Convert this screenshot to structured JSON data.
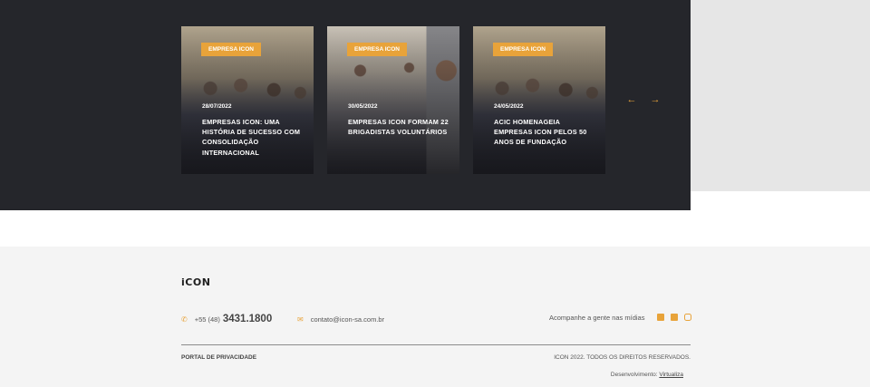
{
  "news": {
    "cards": [
      {
        "badge": "EMPRESA ICON",
        "date": "28/07/2022",
        "title": "EMPRESAS ICON: UMA HISTÓRIA DE SUCESSO COM CONSOLIDAÇÃO INTERNACIONAL"
      },
      {
        "badge": "EMPRESA ICON",
        "date": "30/05/2022",
        "title": "EMPRESAS ICON FORMAM 22 BRIGADISTAS VOLUNTÁRIOS"
      },
      {
        "badge": "EMPRESA ICON",
        "date": "24/05/2022",
        "title": "ACIC HOMENAGEIA EMPRESAS ICON PELOS 50 ANOS DE FUNDAÇÃO"
      }
    ],
    "prev_icon": "arrow-left-icon",
    "next_icon": "arrow-right-icon"
  },
  "footer": {
    "logo": "iCON",
    "phone_prefix": "+55 (48)",
    "phone_number": "3431.1800",
    "email": "contato@icon-sa.com.br",
    "follow_label": "Acompanhe a gente nas mídias",
    "social": [
      "facebook-icon",
      "linkedin-icon",
      "instagram-icon"
    ],
    "privacy": "PORTAL DE PRIVACIDADE",
    "rights": "ICON 2022. TODOS OS DIREITOS RESERVADOS.",
    "dev_label": "Desenvolvimento:",
    "dev_link": "Virtualiza"
  },
  "colors": {
    "accent": "#e8a33a",
    "dark": "#25262b",
    "footer_bg": "#f4f4f4"
  }
}
